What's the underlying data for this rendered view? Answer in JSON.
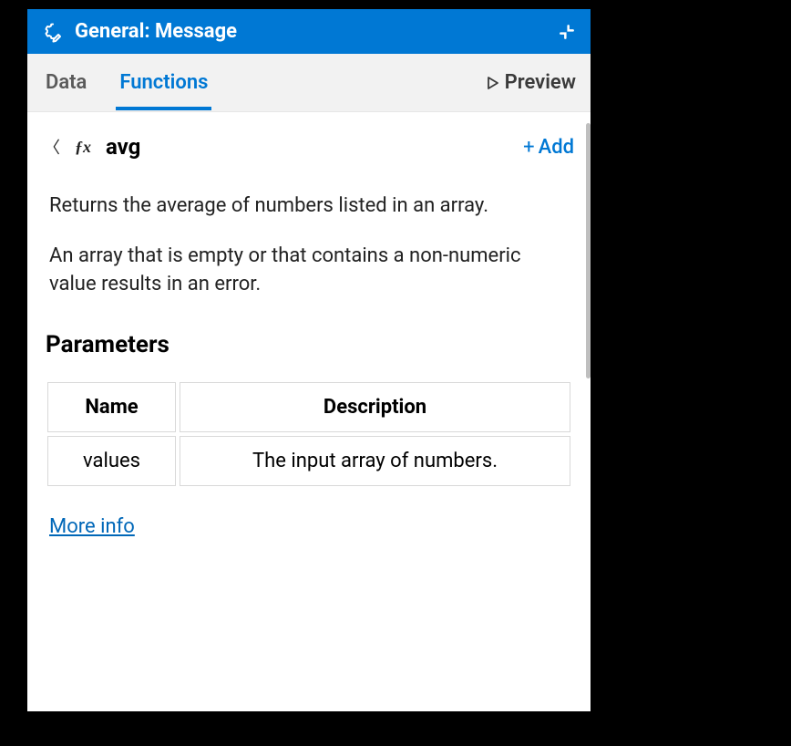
{
  "titlebar": {
    "title": "General: Message"
  },
  "tabs": {
    "data": "Data",
    "functions": "Functions",
    "preview": "Preview"
  },
  "function": {
    "name": "avg",
    "add_label": "Add",
    "description_p1": "Returns the average of numbers listed in an array.",
    "description_p2": "An array that is empty or that contains a non-numeric value results in an error."
  },
  "parameters": {
    "heading": "Parameters",
    "columns": {
      "name": "Name",
      "description": "Description"
    },
    "rows": [
      {
        "name": "values",
        "description": "The input array of numbers."
      }
    ]
  },
  "more_info": "More info"
}
